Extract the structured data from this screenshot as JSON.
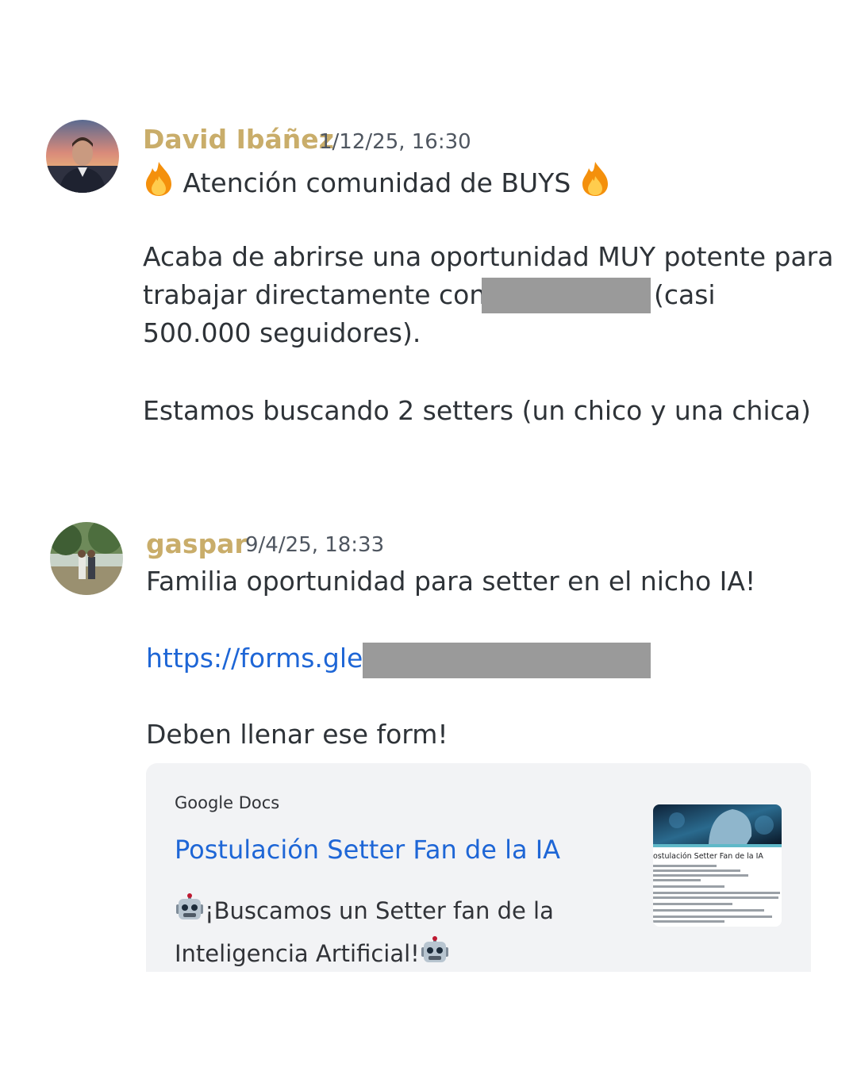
{
  "messages": [
    {
      "author": "David Ibáñez",
      "timestamp": "1/12/25, 16:30",
      "lines": {
        "l1": "Atención comunidad de BUYS",
        "l2": "Acaba de abrirse una oportunidad MUY potente para",
        "l3a": "trabajar directamente con ",
        "l3b": "(casi",
        "l4": "500.000 seguidores).",
        "l5": "Estamos buscando 2 setters (un chico y una chica)"
      }
    },
    {
      "author": "gaspar",
      "timestamp": "9/4/25, 18:33",
      "lines": {
        "l1": "Familia oportunidad para setter en el nicho IA!",
        "link": "https://forms.gle/",
        "l3": "Deben llenar ese form!"
      },
      "embed": {
        "provider": "Google Docs",
        "title": "Postulación Setter Fan de la IA",
        "desc1": "¡Buscamos un Setter fan de la",
        "desc2": "Inteligencia Artificial!",
        "thumb_title": "ostulación Setter Fan de la IA"
      }
    }
  ],
  "icons": {
    "fire": "fire-emoji-icon",
    "robot": "robot-emoji-icon"
  },
  "colors": {
    "author": "#c9ad6a",
    "link": "#1e66d6",
    "redaction": "#9a9a9a",
    "embed_bg": "#f2f3f5"
  }
}
